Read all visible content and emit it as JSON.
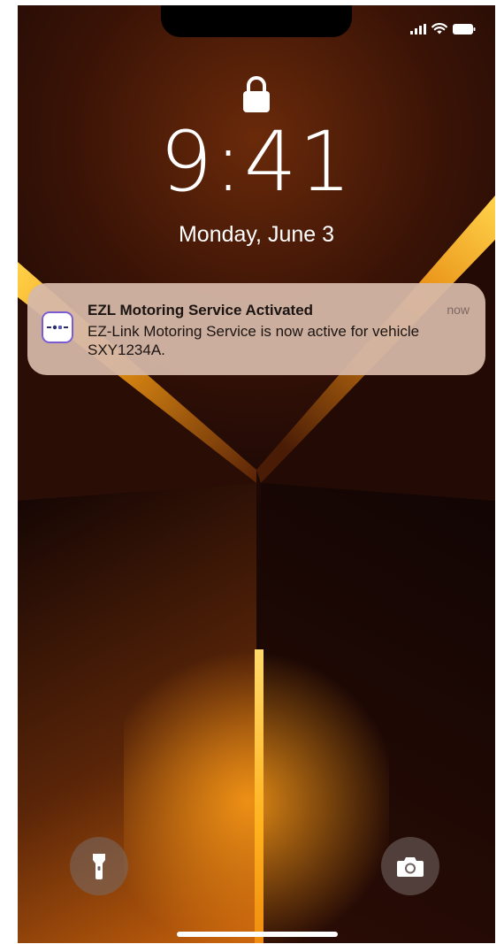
{
  "status_bar": {
    "signal_icon": "cellular-signal-icon",
    "wifi_icon": "wifi-icon",
    "battery_icon": "battery-icon"
  },
  "lock_screen": {
    "lock_icon": "lock-icon",
    "time": "9:41",
    "date": "Monday, June 3"
  },
  "notification": {
    "app_icon": "ez-link-app-icon",
    "title": "EZL Motoring Service Activated",
    "time": "now",
    "body": "EZ-Link Motoring Service is now active for vehicle SXY1234A."
  },
  "quick_actions": {
    "flashlight_icon": "flashlight-icon",
    "camera_icon": "camera-icon"
  },
  "colors": {
    "notification_bg": "#d6b8a8",
    "wallpaper_accent": "#f7b21a",
    "wallpaper_dark": "#160704"
  }
}
